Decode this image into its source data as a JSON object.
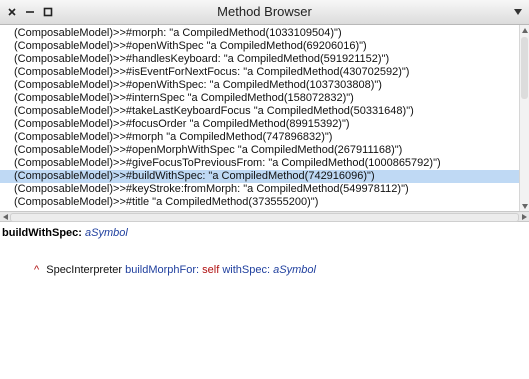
{
  "window": {
    "title": "Method Browser",
    "close_glyph": "×",
    "collapse_glyph": "–",
    "expand_glyph": "□",
    "menu_icon": "chevron-down-icon"
  },
  "methods": [
    "(ComposableModel)>>#morph: \"a CompiledMethod(1033109504)\")",
    "(ComposableModel)>>#openWithSpec \"a CompiledMethod(69206016)\")",
    "(ComposableModel)>>#handlesKeyboard: \"a CompiledMethod(591921152)\")",
    "(ComposableModel)>>#isEventForNextFocus: \"a CompiledMethod(430702592)\")",
    "(ComposableModel)>>#openWithSpec: \"a CompiledMethod(1037303808)\")",
    "(ComposableModel)>>#internSpec \"a CompiledMethod(158072832)\")",
    "(ComposableModel)>>#takeLastKeyboardFocus \"a CompiledMethod(50331648)\")",
    "(ComposableModel)>>#focusOrder \"a CompiledMethod(89915392)\")",
    "(ComposableModel)>>#morph \"a CompiledMethod(747896832)\")",
    "(ComposableModel)>>#openMorphWithSpec \"a CompiledMethod(267911168)\")",
    "(ComposableModel)>>#giveFocusToPreviousFrom: \"a CompiledMethod(1000865792)\")",
    "(ComposableModel)>>#buildWithSpec: \"a CompiledMethod(742916096)\")",
    "(ComposableModel)>>#keyStroke:fromMorph: \"a CompiledMethod(549978112)\")",
    "(ComposableModel)>>#title \"a CompiledMethod(373555200)\")"
  ],
  "selected_index": 11,
  "colors": {
    "selection": "#bfd9f4",
    "argument": "#1f3f9e",
    "keyword": "#b01010"
  },
  "code": {
    "selector": "buildWithSpec:",
    "arg": "aSymbol",
    "caret": "^",
    "receiver": "SpecInterpreter",
    "message": "buildMorphFor:",
    "self_kw": "self",
    "message2": "withSpec:",
    "arg2": "aSymbol"
  }
}
